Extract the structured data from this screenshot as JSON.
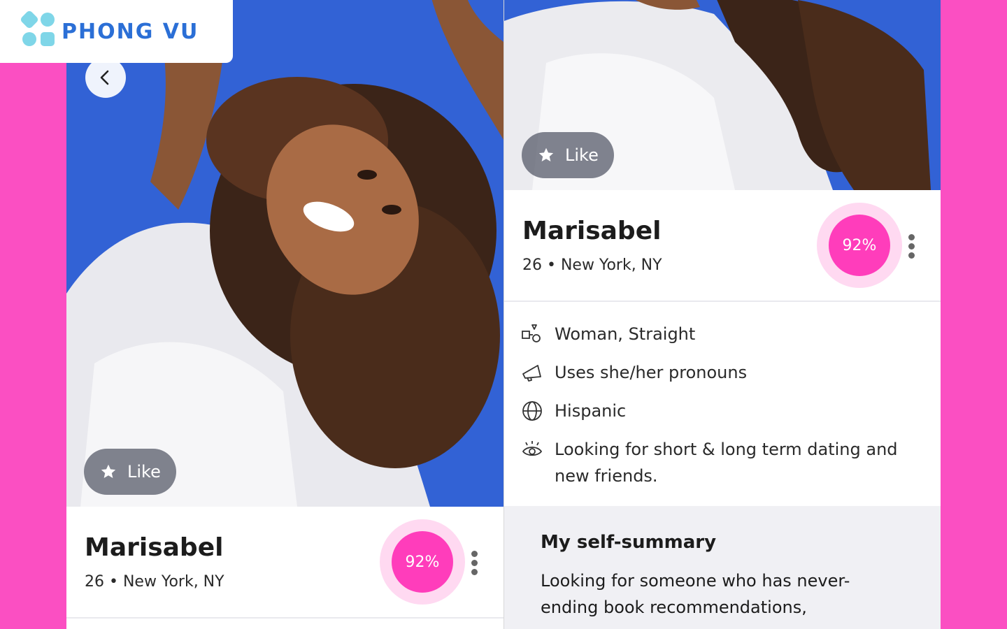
{
  "brand": {
    "logo_text": "PHONG VU",
    "logo_color": "#2b6fd6",
    "logo_accent": "#7fd6e8"
  },
  "colors": {
    "background": "#fb4fc2",
    "match_ring": "#ffd9f1",
    "match_fill": "#ff3dbb"
  },
  "left_screen": {
    "back_icon": "chevron-left-icon",
    "like_label": "Like",
    "name": "Marisabel",
    "subtitle": "26 • New York, NY",
    "match_percent": "92%"
  },
  "right_screen": {
    "like_label": "Like",
    "name": "Marisabel",
    "subtitle": "26 • New York, NY",
    "match_percent": "92%",
    "details": [
      {
        "icon": "gender-shapes-icon",
        "text": "Woman, Straight"
      },
      {
        "icon": "megaphone-icon",
        "text": "Uses she/her pronouns"
      },
      {
        "icon": "globe-icon",
        "text": "Hispanic"
      },
      {
        "icon": "eye-icon",
        "text": "Looking for short & long term dating and new friends."
      }
    ],
    "summary_title": "My self-summary",
    "summary_text": "Looking for someone who has never-ending book recommendations,"
  }
}
